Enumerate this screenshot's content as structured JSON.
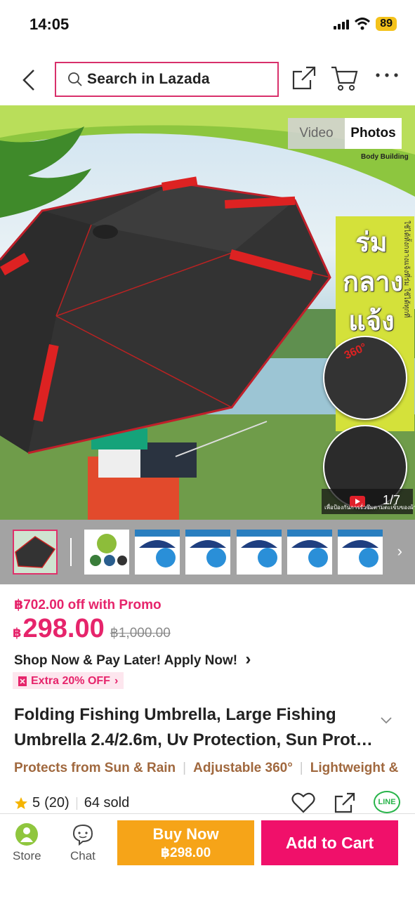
{
  "status_bar": {
    "time": "14:05",
    "battery": "89"
  },
  "header": {
    "search_placeholder": "Search in Lazada"
  },
  "hero": {
    "video_label": "Video",
    "photos_label": "Photos",
    "brand": "Body Building",
    "badge_text": "ร่ม กลาง แจ้ง",
    "badge_side": "ใช้ได้ทั้งกลางแจ้งที่ร่ม ใช้ได้ทุกที่",
    "counter": "1/7",
    "caption": "เพื่อป้องกันการรั่วซึมตามตะเข็บของผ้าร่ม",
    "angle_label": "360°"
  },
  "thumbnails": {
    "count": 7,
    "selected_index": 0
  },
  "pricing": {
    "promo": "฿702.00 off with Promo",
    "currency": "฿",
    "price": "298.00",
    "original_price": "฿1,000.00",
    "pay_later": "Shop Now & Pay Later! Apply Now!",
    "voucher": "Extra 20% OFF"
  },
  "product": {
    "title": "Folding Fishing Umbrella, Large Fishing Umbrella 2.4/2.6m, Uv Protection, Sun Prot…",
    "tags": [
      "Protects from Sun & Rain",
      "Adjustable 360°",
      "Lightweight &"
    ],
    "rating": "5",
    "reviews": "(20)",
    "sold": "64 sold",
    "line_label": "LINE"
  },
  "bottom_bar": {
    "store": "Store",
    "chat": "Chat",
    "buy_now": "Buy Now",
    "buy_now_price": "฿298.00",
    "add_to_cart": "Add to Cart"
  },
  "colors": {
    "brand_pink": "#f0106a",
    "buy_orange": "#f6a418",
    "price_pink": "#e6246b",
    "tag_brown": "#a0683e"
  }
}
